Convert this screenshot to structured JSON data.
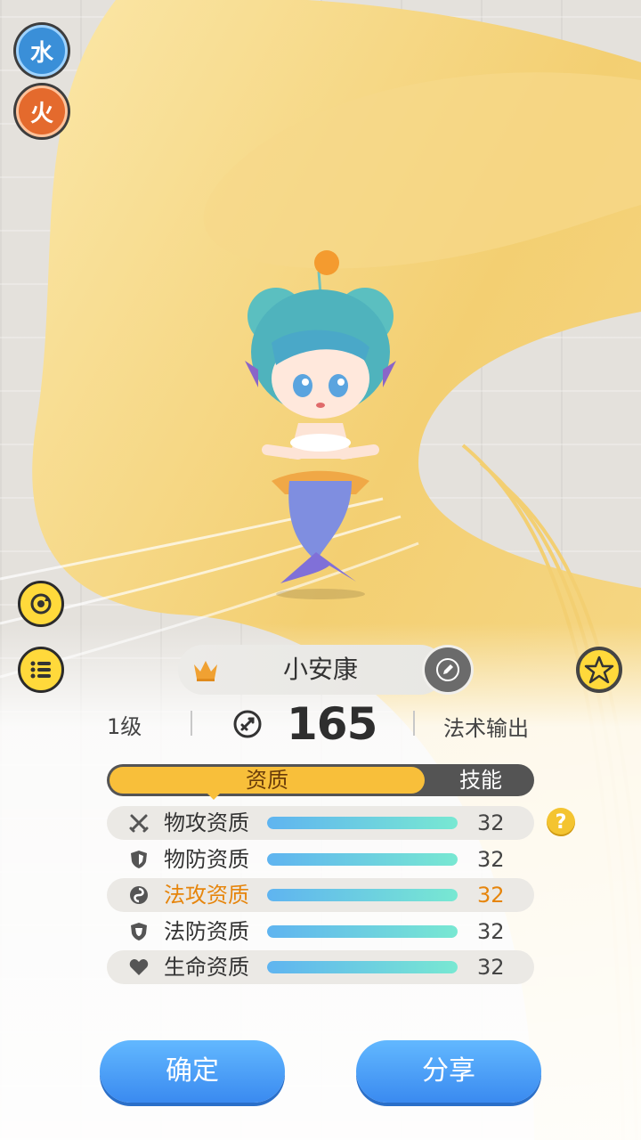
{
  "elements": {
    "water": "水",
    "fire": "火"
  },
  "pet": {
    "name": "小安康",
    "level": "1级",
    "power": "165",
    "role": "法术输出"
  },
  "tabs": {
    "active": "资质",
    "inactive": "技能"
  },
  "stats": [
    {
      "label": "物攻资质",
      "value": "32",
      "icon": "sword-icon",
      "fill": 1.0
    },
    {
      "label": "物防资质",
      "value": "32",
      "icon": "shield-icon",
      "fill": 1.0
    },
    {
      "label": "法攻资质",
      "value": "32",
      "icon": "magic-icon",
      "fill": 1.0
    },
    {
      "label": "法防资质",
      "value": "32",
      "icon": "magic-shield-icon",
      "fill": 1.0
    },
    {
      "label": "生命资质",
      "value": "32",
      "icon": "heart-icon",
      "fill": 1.0
    }
  ],
  "help_label": "?",
  "buttons": {
    "confirm": "确定",
    "share": "分享"
  },
  "colors": {
    "accent": "#f8bf3a",
    "button": "#3a8af0",
    "highlight": "#e6850c",
    "bar_start": "#5fb4f0",
    "bar_end": "#78e8d2"
  }
}
